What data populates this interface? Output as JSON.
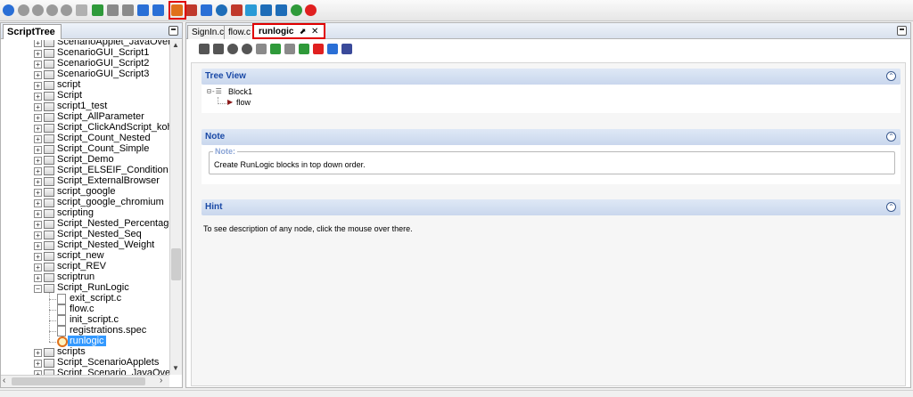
{
  "toolbar": {
    "icons": [
      {
        "name": "run-icon",
        "color": "#2a6fd6"
      },
      {
        "name": "stop-icon",
        "color": "#9a9a9a"
      },
      {
        "name": "pause-icon",
        "color": "#9a9a9a"
      },
      {
        "name": "abort-icon",
        "color": "#9a9a9a"
      },
      {
        "name": "step-icon",
        "color": "#9a9a9a"
      },
      {
        "name": "comment-icon",
        "color": "#b0b0b0"
      },
      {
        "name": "add-icon",
        "color": "#2f9a3a"
      },
      {
        "name": "save-icon",
        "color": "#8a8a8a"
      },
      {
        "name": "copy-icon",
        "color": "#8a8a8a"
      },
      {
        "name": "download-icon",
        "color": "#2a6fd6"
      },
      {
        "name": "upload-icon",
        "color": "#2a6fd6"
      },
      {
        "name": "runlogic-icon",
        "color": "#e0701a"
      },
      {
        "name": "validate-icon",
        "color": "#c0392b"
      },
      {
        "name": "settings-icon",
        "color": "#2a6fd6"
      },
      {
        "name": "gear-icon",
        "color": "#1e6db8"
      },
      {
        "name": "edit-icon",
        "color": "#c0392b"
      },
      {
        "name": "record-icon",
        "color": "#2a9bd6"
      },
      {
        "name": "database-icon",
        "color": "#1e6db8"
      },
      {
        "name": "monitor-icon",
        "color": "#1e6db8"
      },
      {
        "name": "refresh-icon",
        "color": "#2f9a3a"
      },
      {
        "name": "power-icon",
        "color": "#e02020"
      }
    ]
  },
  "left_panel": {
    "tab_label": "ScriptTree",
    "items": [
      {
        "label": "ScenarioApplet_JavaOver",
        "type": "folder",
        "level": 0
      },
      {
        "label": "ScenarioGUI_Script1",
        "type": "folder",
        "level": 0
      },
      {
        "label": "ScenarioGUI_Script2",
        "type": "folder",
        "level": 0
      },
      {
        "label": "ScenarioGUI_Script3",
        "type": "folder",
        "level": 0
      },
      {
        "label": "script",
        "type": "folder",
        "level": 0
      },
      {
        "label": "Script",
        "type": "folder",
        "level": 0
      },
      {
        "label": "script1_test",
        "type": "folder",
        "level": 0
      },
      {
        "label": "Script_AllParameter",
        "type": "folder",
        "level": 0
      },
      {
        "label": "Script_ClickAndScript_kohls",
        "type": "folder",
        "level": 0
      },
      {
        "label": "Script_Count_Nested",
        "type": "folder",
        "level": 0
      },
      {
        "label": "Script_Count_Simple",
        "type": "folder",
        "level": 0
      },
      {
        "label": "Script_Demo",
        "type": "folder",
        "level": 0
      },
      {
        "label": "Script_ELSEIF_Condition",
        "type": "folder",
        "level": 0
      },
      {
        "label": "Script_ExternalBrowser",
        "type": "folder",
        "level": 0
      },
      {
        "label": "script_google",
        "type": "folder",
        "level": 0
      },
      {
        "label": "script_google_chromium",
        "type": "folder",
        "level": 0
      },
      {
        "label": "scripting",
        "type": "folder",
        "level": 0
      },
      {
        "label": "Script_Nested_Percentage",
        "type": "folder",
        "level": 0
      },
      {
        "label": "Script_Nested_Seq",
        "type": "folder",
        "level": 0
      },
      {
        "label": "Script_Nested_Weight",
        "type": "folder",
        "level": 0
      },
      {
        "label": "script_new",
        "type": "folder",
        "level": 0
      },
      {
        "label": "script_REV",
        "type": "folder",
        "level": 0
      },
      {
        "label": "scriptrun",
        "type": "folder",
        "level": 0
      },
      {
        "label": "Script_RunLogic",
        "type": "folder-open",
        "level": 0
      },
      {
        "label": "exit_script.c",
        "type": "file",
        "level": 1
      },
      {
        "label": "flow.c",
        "type": "file",
        "level": 1
      },
      {
        "label": "init_script.c",
        "type": "file",
        "level": 1
      },
      {
        "label": "registrations.spec",
        "type": "file",
        "level": 1
      },
      {
        "label": "runlogic",
        "type": "runlogic",
        "level": 1,
        "selected": true
      },
      {
        "label": "scripts",
        "type": "folder",
        "level": 0
      },
      {
        "label": "Script_ScenarioApplets",
        "type": "folder",
        "level": 0
      },
      {
        "label": "Script_Scenario_JavaOverl",
        "type": "folder",
        "level": 0
      }
    ]
  },
  "editor": {
    "tabs": [
      {
        "label": "SignIn.c",
        "active": false
      },
      {
        "label": "flow.c",
        "active": false
      },
      {
        "label": "runlogic",
        "active": true
      }
    ],
    "tab_close": "✕",
    "tab_pin": "⬈",
    "toolbar_icons": [
      {
        "name": "new-block-icon",
        "color": "#555555"
      },
      {
        "name": "add-block-icon",
        "color": "#555555"
      },
      {
        "name": "move-up-icon",
        "color": "#555555"
      },
      {
        "name": "move-down-icon",
        "color": "#555555"
      },
      {
        "name": "save-icon",
        "color": "#8a8a8a"
      },
      {
        "name": "loop-icon",
        "color": "#2f9a3a"
      },
      {
        "name": "copy-icon",
        "color": "#8a8a8a"
      },
      {
        "name": "expand-icon",
        "color": "#2f9a3a"
      },
      {
        "name": "collapse-icon",
        "color": "#e02020"
      },
      {
        "name": "download-icon",
        "color": "#2a6fd6"
      },
      {
        "name": "document-icon",
        "color": "#3a4a9a"
      }
    ],
    "sections": {
      "tree_view": {
        "title": "Tree View",
        "collapse": "⌃",
        "root": "Block1",
        "child": "flow"
      },
      "note": {
        "title": "Note",
        "collapse": "⌃",
        "legend": "Note:",
        "text": "Create RunLogic blocks in top down order."
      },
      "hint": {
        "title": "Hint",
        "collapse": "⌃",
        "text": "To see description of any node, click the mouse over there."
      }
    }
  }
}
